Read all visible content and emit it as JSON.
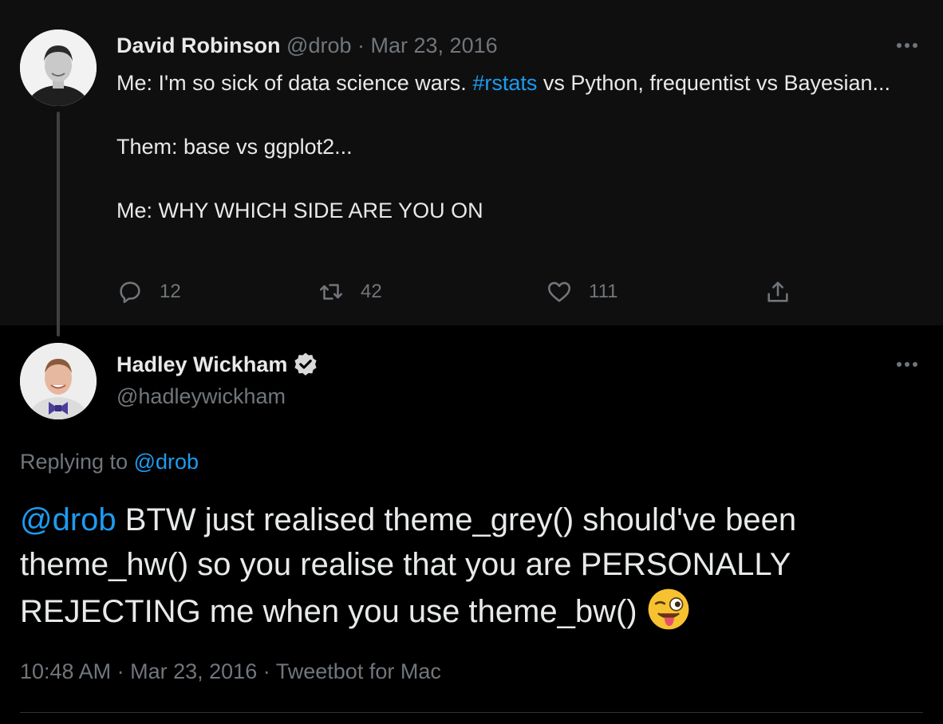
{
  "parent_tweet": {
    "author_name": "David Robinson",
    "handle": "@drob",
    "separator": "·",
    "date": "Mar 23, 2016",
    "text_lines": [
      {
        "before": "Me: I'm so sick of data science wars. ",
        "hashtag": "#rstats",
        "after": " vs Python, frequentist vs Bayesian..."
      },
      "Them: base vs ggplot2...",
      "Me: WHY WHICH SIDE ARE YOU ON"
    ],
    "counts": {
      "replies": "12",
      "retweets": "42",
      "likes": "111"
    }
  },
  "reply_tweet": {
    "author_name": "Hadley Wickham",
    "handle": "@hadleywickham",
    "replying_prefix": "Replying to",
    "replying_to": "@drob",
    "mention": "@drob",
    "text": " BTW just realised theme_grey() should've been theme_hw() so you realise that you are PERSONALLY REJECTING me when you use theme_bw() ",
    "time": "10:48 AM",
    "date": "Mar 23, 2016",
    "source": "Tweetbot for Mac",
    "separator": "·"
  },
  "icons": {
    "reply": "reply-icon",
    "retweet": "retweet-icon",
    "like": "heart-icon",
    "share": "share-icon",
    "verified": "verified-badge-icon",
    "more": "more-dots-icon",
    "emoji": "winking-tongue-emoji"
  },
  "colors": {
    "background": "#000000",
    "parent_background": "#0f0f0f",
    "text": "#e7e9ea",
    "muted": "#71767b",
    "link": "#1d9bf0"
  }
}
